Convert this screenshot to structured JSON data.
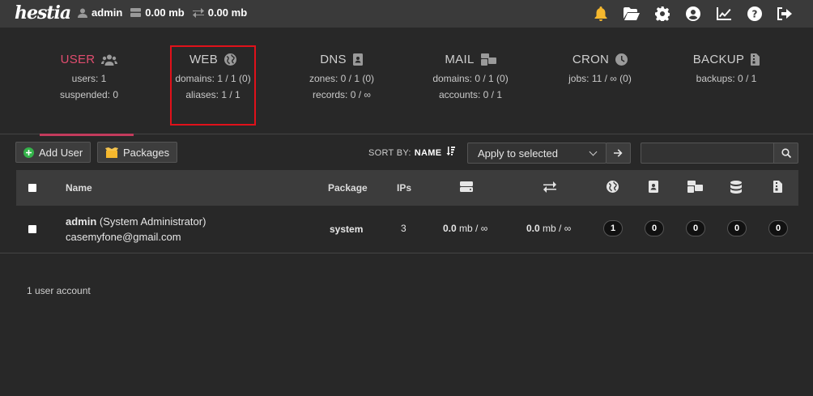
{
  "app": {
    "logo_text": "hestia",
    "username": "admin",
    "disk_usage": "0.00 mb",
    "bandwidth_usage": "0.00 mb"
  },
  "topbar_icons": [
    "bell-icon",
    "folder-open-icon",
    "gear-icon",
    "user-circle-icon",
    "chart-line-icon",
    "help-icon",
    "logout-icon"
  ],
  "tabs": [
    {
      "title": "USER",
      "icon": "users-icon",
      "lines": [
        "users: 1",
        "suspended: 0"
      ],
      "active": true
    },
    {
      "title": "WEB",
      "icon": "globe-icon",
      "lines": [
        "domains: 1 / 1 (0)",
        "aliases: 1 / 1"
      ]
    },
    {
      "title": "DNS",
      "icon": "address-book-icon",
      "lines": [
        "zones: 0 / 1 (0)",
        "records: 0 / ∞"
      ]
    },
    {
      "title": "MAIL",
      "icon": "mail-bulk-icon",
      "lines": [
        "domains: 0 / 1 (0)",
        "accounts: 0 / 1"
      ]
    },
    {
      "title": "CRON",
      "icon": "clock-icon",
      "lines": [
        "jobs: 11 / ∞ (0)",
        ""
      ]
    },
    {
      "title": "BACKUP",
      "icon": "file-archive-icon",
      "lines": [
        "backups: 0 / 1",
        ""
      ]
    }
  ],
  "toolbar": {
    "add_user_label": "Add User",
    "packages_label": "Packages",
    "sort_by_label": "SORT BY:",
    "sort_by_value": "NAME",
    "bulk_action_selected": "Apply to selected",
    "search_placeholder": ""
  },
  "table": {
    "headers": {
      "name": "Name",
      "package": "Package",
      "ips": "IPs"
    },
    "rows": [
      {
        "username": "admin",
        "role": "(System Administrator)",
        "email": "casemyfone@gmail.com",
        "package": "system",
        "ips": "3",
        "disk_value": "0.0",
        "disk_unit": "mb / ∞",
        "bandwidth_value": "0.0",
        "bandwidth_unit": "mb / ∞",
        "web_domains": "1",
        "dns_domains": "0",
        "mail_domains": "0",
        "databases": "0",
        "backups": "0"
      }
    ]
  },
  "footer": {
    "count_text": "1 user account"
  },
  "colors": {
    "accent": "#e14d6f",
    "highlight": "#e0111a",
    "background": "#282828"
  }
}
